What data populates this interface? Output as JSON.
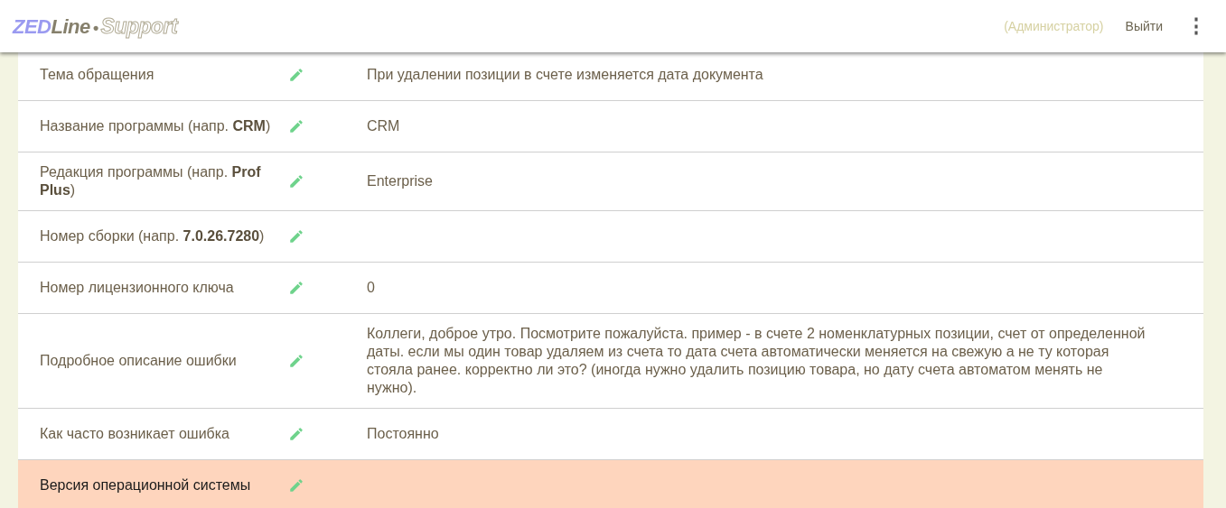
{
  "header": {
    "logo": {
      "brand_first": "ZED",
      "brand_second": "Line",
      "separator": "•",
      "product": "Support"
    },
    "role": "(Администратор)",
    "logout": "Выйти",
    "menu": "⋮"
  },
  "fields": [
    {
      "label": "Тема обращения",
      "value": "При удалении позиции в счете изменяется дата документа",
      "highlighted": false
    },
    {
      "label": "Название программы (напр. **CRM**)",
      "value": "CRM",
      "highlighted": false
    },
    {
      "label": "Редакция программы (напр. **Prof Plus**)",
      "value": "Enterprise",
      "highlighted": false
    },
    {
      "label": "Номер сборки (напр. **7.0.26.7280**)",
      "highlighted": false
    },
    {
      "label": "Номер лицензионного ключа",
      "value": "0",
      "highlighted": false
    },
    {
      "label": "Подробное описание ошибки",
      "value": "Коллеги, доброе утро. Посмотрите пожалуйста. пример - в счете 2 номенклатурных позиции, счет от определенной даты. если мы один товар удаляем из счета то дата счета автоматически меняется на свежую а не ту которая стояла ранее. корректно ли это? (иногда нужно удалить позицию товара, но дату счета автоматом менять не нужно).",
      "highlighted": false
    },
    {
      "label": "Как часто возникает ошибка",
      "value": "Постоянно",
      "highlighted": false
    },
    {
      "label": "Версия операционной системы",
      "highlighted": true
    }
  ]
}
